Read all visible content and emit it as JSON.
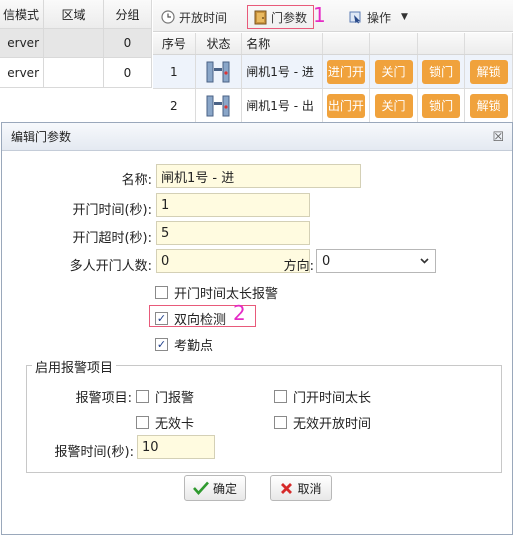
{
  "left_grid": {
    "headers": [
      "信模式",
      "区域",
      "分组"
    ],
    "rows": [
      {
        "mode": "erver",
        "area": "",
        "group": "0"
      },
      {
        "mode": "erver",
        "area": "",
        "group": "0"
      }
    ]
  },
  "toolbar": {
    "open_time_label": "开放时间",
    "door_param_label": "门参数",
    "operate_label": "操作",
    "marker1": "1"
  },
  "door_table": {
    "headers": {
      "idx": "序号",
      "status": "状态",
      "name": "名称"
    },
    "rows": [
      {
        "idx": "1",
        "name": "闸机1号 - 进",
        "actions": [
          "进门开",
          "关门",
          "锁门",
          "解锁"
        ]
      },
      {
        "idx": "2",
        "name": "闸机1号 - 出",
        "actions": [
          "出门开",
          "关门",
          "锁门",
          "解锁"
        ]
      }
    ]
  },
  "dialog": {
    "title": "编辑门参数",
    "close_glyph": "☒",
    "name_label": "名称:",
    "name_value": "闸机1号 - 进",
    "open_time_label": "开门时间(秒):",
    "open_time_value": "1",
    "timeout_label": "开门超时(秒):",
    "timeout_value": "5",
    "multi_label": "多人开门人数:",
    "multi_value": "0",
    "direction_label": "方向:",
    "direction_value": "0",
    "chk_long_alarm": "开门时间太长报警",
    "chk_bidirectional": "双向检测",
    "chk_attendance": "考勤点",
    "marker2": "2",
    "alarm_group_title": "启用报警项目",
    "alarm_items_label": "报警项目:",
    "alarm_door": "门报警",
    "alarm_open_long": "门开时间太长",
    "alarm_invalid_card": "无效卡",
    "alarm_invalid_time": "无效开放时间",
    "alarm_time_label": "报警时间(秒):",
    "alarm_time_value": "10",
    "ok_label": "确定",
    "cancel_label": "取消"
  },
  "checkbox_states": {
    "long_alarm": false,
    "bidirectional": true,
    "attendance": true,
    "alarm_door": false,
    "alarm_open_long": false,
    "alarm_invalid_card": false,
    "alarm_invalid_time": false
  },
  "colors": {
    "action_button": "#f0a23c",
    "marker": "#e52bc5",
    "highlight_border": "#e85a7a",
    "input_bg": "#fffbe0"
  },
  "icons": [
    "clock-icon",
    "door-icon",
    "operate-icon",
    "gate-icon",
    "check-icon",
    "cancel-icon"
  ]
}
